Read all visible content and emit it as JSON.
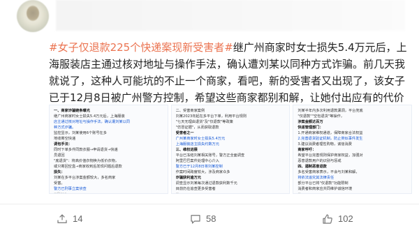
{
  "post": {
    "tag": "#女子仅退款225个快递案现新受害者#",
    "body": "继广州商家时女士损失5.4万元后，上海服装店主通过核对地址与操作手法，确认遭刘某以同种方式诈骗。前几天我就说了，这种人可能坑的不止一个商家，看吧，新的受害者又出现了，该女子已于12月8日被广州警方控制，希望这些商家都别和解，让她付出应有的代价"
  },
  "images": [
    {
      "lines": [
        {
          "t": "一、商家诈骗链条曝光",
          "sec": true
        },
        {
          "t": "继广州商家时女士损失5.4万元后，上海服装"
        },
        {
          "t": "店主通过核对地址与操作手法，确认遭刘某以同",
          "hl": true
        },
        {
          "t": "种方式诈骗。",
          "hl": true
        },
        {
          "t": "监控显示，刘某使用6个账号在多"
        },
        {
          "t": "地收寄空快递"
        },
        {
          "t": "调包手法：",
          "sec": true
        },
        {
          "t": "同时下单多件同款衣服→申请退货→快递"
        },
        {
          "t": "员退回"
        },
        {
          "t": "\"底退货\"：将高价值衣物换为低价衣物，"
        },
        {
          "t": "或只寄回空盒→商家收到后发现问题后退款"
        },
        {
          "t": "损失：",
          "sec": true
        },
        {
          "t": "刘某在多平台涉案金额较大，多名商家"
        },
        {
          "t": "受害。"
        },
        {
          "t": "警方已刑事立案侦查",
          "hl": true
        },
        {
          "t": "@Qiang...",
          "src": true
        }
      ]
    },
    {
      "lines": [
        {
          "t": "二、受害商家案例"
        },
        {
          "t": "刘某2023年起在多平台下单，利用平台规则"
        },
        {
          "t": "\"七天无理由退货\"及\"仅退款\"等政策"
        },
        {
          "t": "\"仿冒证据\"，从而获取退款"
        },
        {
          "t": "受害者之一",
          "sec": true
        },
        {
          "t": "广州某商家时女士损失5.4万元",
          "hl": true
        },
        {
          "t": "上海服装店主损失约数万元",
          "hl": true
        },
        {
          "t": "三、维权进展",
          "sec": true
        },
        {
          "t": "平台已冻结刘某相关账号，警方正全面调查"
        },
        {
          "t": "阿里巴巴案件处理中心介入"
        },
        {
          "t": "警方已于12月8日将刘某控制",
          "hl": true
        },
        {
          "t": "作案时间跨度较大，涉及商家众多"
        },
        {
          "t": "诈骗获利逾万元",
          "sec": true
        },
        {
          "t": "调查显示刘某每次通过退款获利数千元"
        },
        {
          "t": "目前仍在追查更多受害者"
        },
        {
          "t": "@...",
          "src": true
        }
      ]
    },
    {
      "lines": [
        {
          "t": "刘某半年内多次利用退款漏洞，平台兜底"
        },
        {
          "t": "\"仅退款\"\"空包退货\"等操作，"
        },
        {
          "t": "涉案金额达百万",
          "sec": true
        },
        {
          "t": "快递管理部门：",
          "sec": true
        },
        {
          "t": "1.开通商家维权通道，保障商家合法权益"
        },
        {
          "t": "2.完善退货验证机制，防止类似事件发生",
          "hl": true
        },
        {
          "t": "3.建议消费者理性购物，诚信消费"
        },
        {
          "t": "商家呼吁：",
          "sec": true
        },
        {
          "t": "希望平台完善规则保护商家权益，加强对"
        },
        {
          "t": "恶意退款用户的识别与惩戒"
        },
        {
          "t": "四、遏制恶意退款",
          "sec": true
        },
        {
          "t": "多名受害商家表示，不会与刘某和解，"
        },
        {
          "t": "将依法追究其法律责任",
          "hl": true
        },
        {
          "t": "部分平台已将\"仅退款\"功能限制"
        },
        {
          "t": "消费者和商家应共同维护诚信环境"
        },
        {
          "t": "@...",
          "src": true
        }
      ]
    }
  ],
  "actions": {
    "share_count": "14",
    "comment_count": "58",
    "like_count": "102"
  }
}
